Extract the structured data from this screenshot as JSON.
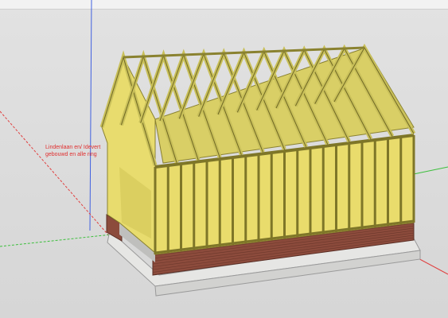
{
  "app": "3D modeling viewport",
  "scene": {
    "subject": "timber-frame-house-model",
    "label_line_1": "Lindenlaan en/ Idevert",
    "label_line_2": "gebouwd en alle ring",
    "colors": {
      "background": "#dcdcdc",
      "timber": "#c9c05a",
      "timber_dark": "#8a8230",
      "sheathing": "#e8dc6e",
      "brick": "#8c4b3c",
      "concrete": "#e8e8e6",
      "axis_red": "#e04040",
      "axis_green": "#3cbf3c",
      "axis_blue": "#4060e0"
    }
  }
}
